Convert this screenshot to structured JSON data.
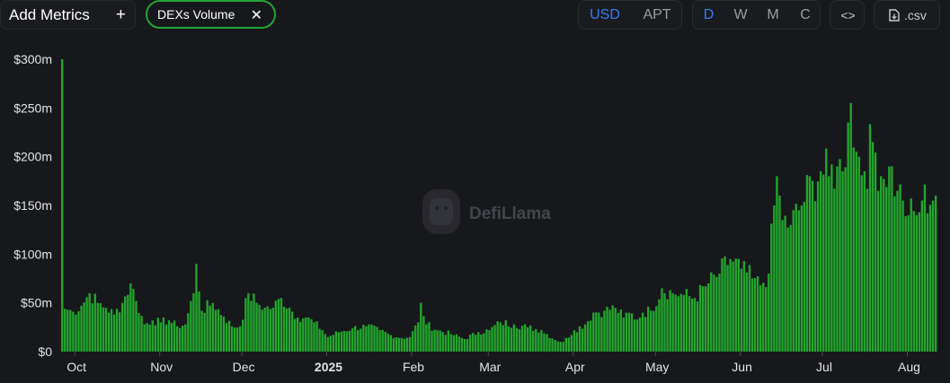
{
  "toolbar": {
    "add_metrics_label": "Add Metrics",
    "add_icon": "plus-icon",
    "metric_chip_label": "DEXs Volume",
    "remove_icon": "close-icon",
    "currency_options": [
      "USD",
      "APT"
    ],
    "currency_selected": "USD",
    "interval_options": [
      "D",
      "W",
      "M",
      "C"
    ],
    "interval_selected": "D",
    "embed_icon": "code-brackets-icon",
    "embed_label": "<>",
    "csv_icon": "file-download-icon",
    "csv_label": ".csv"
  },
  "watermark": {
    "text": "DefiLlama",
    "icon": "llama-logo-icon"
  },
  "colors": {
    "background": "#17181c",
    "bar": "#22a52d",
    "active": "#2f7ff2",
    "chip_border": "#22a537"
  },
  "chart_data": {
    "type": "bar",
    "title": "",
    "series": [
      {
        "name": "DEXs Volume",
        "values": []
      }
    ],
    "ylim": [
      0,
      300
    ],
    "y_ticks": [
      "$0",
      "$50m",
      "$100m",
      "$150m",
      "$200m",
      "$250m",
      "$300m"
    ],
    "y_unit": "USD millions",
    "x_ticks": [
      "Oct",
      "Nov",
      "Dec",
      "2025",
      "Feb",
      "Mar",
      "Apr",
      "May",
      "Jun",
      "Jul",
      "Aug"
    ],
    "x_start": "2024-09-26",
    "x_end": "2025-08-11",
    "grid": false,
    "legend": "none",
    "keypoints": [
      [
        "2024-09-26",
        300
      ],
      [
        "2024-09-27",
        44
      ],
      [
        "2024-09-30",
        41
      ],
      [
        "2024-10-03",
        47
      ],
      [
        "2024-10-06",
        60
      ],
      [
        "2024-10-09",
        50
      ],
      [
        "2024-10-12",
        45
      ],
      [
        "2024-10-15",
        38
      ],
      [
        "2024-10-18",
        50
      ],
      [
        "2024-10-21",
        70
      ],
      [
        "2024-10-23",
        52
      ],
      [
        "2024-10-26",
        28
      ],
      [
        "2024-10-29",
        32
      ],
      [
        "2024-11-01",
        30
      ],
      [
        "2024-11-04",
        32
      ],
      [
        "2024-11-07",
        26
      ],
      [
        "2024-11-10",
        28
      ],
      [
        "2024-11-13",
        60
      ],
      [
        "2024-11-14",
        90
      ],
      [
        "2024-11-16",
        42
      ],
      [
        "2024-11-20",
        50
      ],
      [
        "2024-11-24",
        36
      ],
      [
        "2024-11-27",
        26
      ],
      [
        "2024-11-30",
        26
      ],
      [
        "2024-12-03",
        60
      ],
      [
        "2024-12-06",
        50
      ],
      [
        "2024-12-09",
        45
      ],
      [
        "2024-12-12",
        45
      ],
      [
        "2024-12-15",
        55
      ],
      [
        "2024-12-18",
        45
      ],
      [
        "2024-12-21",
        35
      ],
      [
        "2024-12-24",
        35
      ],
      [
        "2024-12-27",
        30
      ],
      [
        "2024-12-30",
        22
      ],
      [
        "2025-01-01",
        15
      ],
      [
        "2025-01-05",
        20
      ],
      [
        "2025-01-10",
        24
      ],
      [
        "2025-01-15",
        26
      ],
      [
        "2025-01-20",
        22
      ],
      [
        "2025-01-24",
        17
      ],
      [
        "2025-01-28",
        14
      ],
      [
        "2025-01-31",
        15
      ],
      [
        "2025-02-03",
        30
      ],
      [
        "2025-02-04",
        50
      ],
      [
        "2025-02-06",
        28
      ],
      [
        "2025-02-10",
        22
      ],
      [
        "2025-02-15",
        18
      ],
      [
        "2025-02-20",
        13
      ],
      [
        "2025-02-25",
        20
      ],
      [
        "2025-03-01",
        22
      ],
      [
        "2025-03-05",
        30
      ],
      [
        "2025-03-10",
        28
      ],
      [
        "2025-03-15",
        25
      ],
      [
        "2025-03-20",
        22
      ],
      [
        "2025-03-25",
        12
      ],
      [
        "2025-03-28",
        10
      ],
      [
        "2025-04-01",
        22
      ],
      [
        "2025-04-05",
        28
      ],
      [
        "2025-04-08",
        40
      ],
      [
        "2025-04-12",
        42
      ],
      [
        "2025-04-16",
        45
      ],
      [
        "2025-04-19",
        35
      ],
      [
        "2025-04-21",
        40
      ],
      [
        "2025-04-24",
        33
      ],
      [
        "2025-04-26",
        40
      ],
      [
        "2025-04-29",
        42
      ],
      [
        "2025-05-03",
        65
      ],
      [
        "2025-05-07",
        60
      ],
      [
        "2025-05-11",
        58
      ],
      [
        "2025-05-15",
        55
      ],
      [
        "2025-05-20",
        70
      ],
      [
        "2025-05-24",
        80
      ],
      [
        "2025-05-28",
        95
      ],
      [
        "2025-06-01",
        85
      ],
      [
        "2025-06-05",
        75
      ],
      [
        "2025-06-08",
        68
      ],
      [
        "2025-06-11",
        80
      ],
      [
        "2025-06-13",
        150
      ],
      [
        "2025-06-14",
        180
      ],
      [
        "2025-06-16",
        135
      ],
      [
        "2025-06-19",
        130
      ],
      [
        "2025-06-23",
        150
      ],
      [
        "2025-06-27",
        175
      ],
      [
        "2025-06-30",
        185
      ],
      [
        "2025-07-03",
        180
      ],
      [
        "2025-07-06",
        190
      ],
      [
        "2025-07-08",
        185
      ],
      [
        "2025-07-10",
        235
      ],
      [
        "2025-07-11",
        255
      ],
      [
        "2025-07-13",
        205
      ],
      [
        "2025-07-16",
        185
      ],
      [
        "2025-07-19",
        215
      ],
      [
        "2025-07-22",
        180
      ],
      [
        "2025-07-25",
        190
      ],
      [
        "2025-07-28",
        165
      ],
      [
        "2025-07-30",
        155
      ],
      [
        "2025-08-01",
        140
      ],
      [
        "2025-08-04",
        140
      ],
      [
        "2025-08-06",
        155
      ],
      [
        "2025-08-11",
        160
      ]
    ]
  }
}
